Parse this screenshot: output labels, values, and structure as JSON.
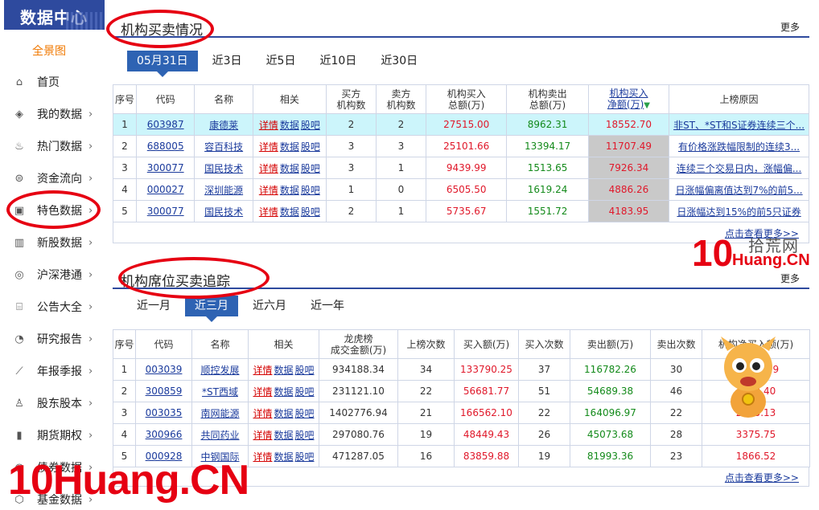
{
  "sidebar": {
    "logo": "数据中心",
    "panorama": "全景图",
    "items": [
      {
        "label": "首页",
        "icon": "⌂",
        "arrow": ""
      },
      {
        "label": "我的数据",
        "icon": "◈",
        "arrow": "›"
      },
      {
        "label": "热门数据",
        "icon": "♨",
        "arrow": "›"
      },
      {
        "label": "资金流向",
        "icon": "⊜",
        "arrow": "›"
      },
      {
        "label": "特色数据",
        "icon": "▣",
        "arrow": "›"
      },
      {
        "label": "新股数据",
        "icon": "▥",
        "arrow": "›"
      },
      {
        "label": "沪深港通",
        "icon": "◎",
        "arrow": "›"
      },
      {
        "label": "公告大全",
        "icon": "⌸",
        "arrow": "›"
      },
      {
        "label": "研究报告",
        "icon": "◔",
        "arrow": "›"
      },
      {
        "label": "年报季报",
        "icon": "⟋",
        "arrow": "›"
      },
      {
        "label": "股东股本",
        "icon": "♙",
        "arrow": "›"
      },
      {
        "label": "期货期权",
        "icon": "▮",
        "arrow": "›"
      },
      {
        "label": "债券数据",
        "icon": "◉",
        "arrow": "›"
      },
      {
        "label": "基金数据",
        "icon": "⬡",
        "arrow": "›"
      }
    ]
  },
  "section1": {
    "title": "机构买卖情况",
    "more": "更多",
    "tabs": [
      "05月31日",
      "近3日",
      "近5日",
      "近10日",
      "近30日"
    ],
    "headers": [
      "序号",
      "代码",
      "名称",
      "相关",
      "买方\n机构数",
      "卖方\n机构数",
      "机构买入\n总额(万)",
      "机构卖出\n总额(万)",
      "机构买入\n净额(万)",
      "上榜原因"
    ],
    "related": [
      "详情",
      "数据",
      "股吧"
    ],
    "rows": [
      {
        "no": "1",
        "code": "603987",
        "name": "康德莱",
        "buy_n": "2",
        "sell_n": "2",
        "buy": "27515.00",
        "sell": "8962.31",
        "net": "18552.70",
        "reason": "非ST、*ST和S证券连续三个..."
      },
      {
        "no": "2",
        "code": "688005",
        "name": "容百科技",
        "buy_n": "3",
        "sell_n": "3",
        "buy": "25101.66",
        "sell": "13394.17",
        "net": "11707.49",
        "reason": "有价格涨跌幅限制的连续3..."
      },
      {
        "no": "3",
        "code": "300077",
        "name": "国民技术",
        "buy_n": "3",
        "sell_n": "1",
        "buy": "9439.99",
        "sell": "1513.65",
        "net": "7926.34",
        "reason": "连续三个交易日内，涨幅偏..."
      },
      {
        "no": "4",
        "code": "000027",
        "name": "深圳能源",
        "buy_n": "1",
        "sell_n": "0",
        "buy": "6505.50",
        "sell": "1619.24",
        "net": "4886.26",
        "reason": "日涨幅偏离值达到7%的前5..."
      },
      {
        "no": "5",
        "code": "300077",
        "name": "国民技术",
        "buy_n": "2",
        "sell_n": "1",
        "buy": "5735.67",
        "sell": "1551.72",
        "net": "4183.95",
        "reason": "日涨幅达到15%的前5只证券"
      }
    ],
    "click_more": "点击查看更多>>"
  },
  "section2": {
    "title": "机构席位买卖追踪",
    "more": "更多",
    "tabs": [
      "近一月",
      "近三月",
      "近六月",
      "近一年"
    ],
    "headers": [
      "序号",
      "代码",
      "名称",
      "相关",
      "龙虎榜\n成交金额(万)",
      "上榜次数",
      "买入额(万)",
      "买入次数",
      "卖出额(万)",
      "卖出次数",
      "机构净买入额(万)"
    ],
    "related": [
      "详情",
      "数据",
      "股吧"
    ],
    "rows": [
      {
        "no": "1",
        "code": "003039",
        "name": "顺控发展",
        "amount": "934188.34",
        "times": "34",
        "buy": "133790.25",
        "buy_n": "37",
        "sell": "116782.26",
        "sell_n": "30",
        "net": "17007.99"
      },
      {
        "no": "2",
        "code": "300859",
        "name": "*ST西域",
        "amount": "231121.10",
        "times": "22",
        "buy": "56681.77",
        "buy_n": "51",
        "sell": "54689.38",
        "sell_n": "46",
        "net": "1992.40"
      },
      {
        "no": "3",
        "code": "003035",
        "name": "南网能源",
        "amount": "1402776.94",
        "times": "21",
        "buy": "166562.10",
        "buy_n": "22",
        "sell": "164096.97",
        "sell_n": "22",
        "net": "2465.13"
      },
      {
        "no": "4",
        "code": "300966",
        "name": "共同药业",
        "amount": "297080.76",
        "times": "19",
        "buy": "48449.43",
        "buy_n": "26",
        "sell": "45073.68",
        "sell_n": "28",
        "net": "3375.75"
      },
      {
        "no": "5",
        "code": "000928",
        "name": "中钢国际",
        "amount": "471287.05",
        "times": "16",
        "buy": "83859.88",
        "buy_n": "19",
        "sell": "81993.36",
        "sell_n": "23",
        "net": "1866.52"
      }
    ],
    "click_more": "点击查看更多>>"
  },
  "watermark": {
    "big": "10Huang.CN",
    "logo_num": "10",
    "logo_cn": "拾荒网",
    "logo_en": "Huang.CN"
  },
  "colors": {
    "accent": "#2e4a9e",
    "tab_active": "#2e63b3",
    "annotation": "#e60012"
  }
}
